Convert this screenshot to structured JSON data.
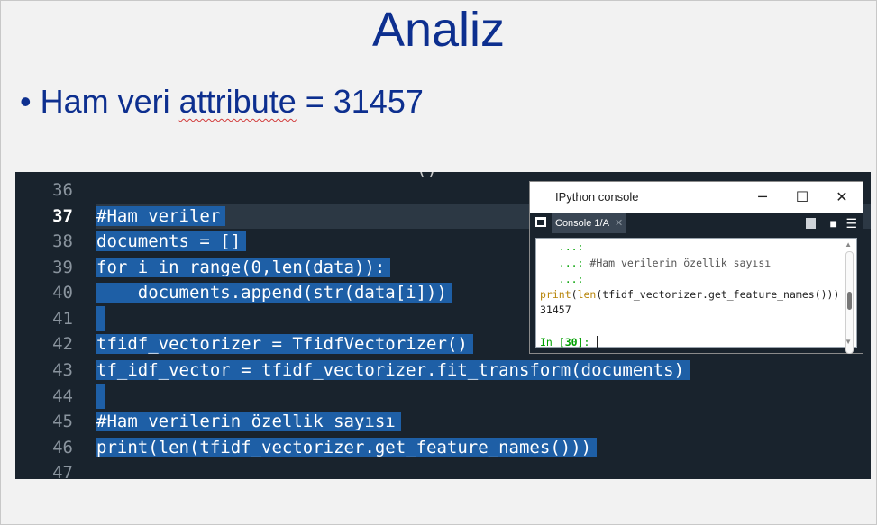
{
  "slide": {
    "title": "Analiz",
    "bullet": {
      "marker": "•",
      "prefix": "Ham veri ",
      "squiggle_word": "attribute",
      "suffix": " = 31457"
    }
  },
  "editor": {
    "top_fragment": "()",
    "line_numbers": [
      "36",
      "37",
      "38",
      "39",
      "40",
      "41",
      "42",
      "43",
      "44",
      "45",
      "46",
      "47"
    ],
    "active_line": "37",
    "code_lines": [
      "",
      "#Ham veriler",
      "documents = []",
      "for i in range(0,len(data)):",
      "    documents.append(str(data[i]))",
      "",
      "tfidf_vectorizer = TfidfVectorizer()",
      "tf_idf_vector = tfidf_vectorizer.fit_transform(documents)",
      "",
      "#Ham verilerin özellik sayısı",
      "print(len(tfidf_vectorizer.get_feature_names()))",
      ""
    ]
  },
  "console": {
    "window_title": "IPython console",
    "minimize": "─",
    "maximize": "☐",
    "close": "✕",
    "tab_label": "Console 1/A",
    "tab_close": "✕",
    "output": {
      "cont1": "   ...:",
      "cont2_prompt": "   ...: ",
      "cont2_comment": "#Ham verilerin özellik sayısı",
      "cont3": "   ...:",
      "print_fn": "print",
      "print_open": "(",
      "len_fn": "len",
      "print_rest": "(tfidf_vectorizer.get_feature_names()))",
      "result": "31457",
      "prompt_in": "In [",
      "prompt_num": "30",
      "prompt_close": "]: "
    },
    "colors": {
      "prompt_green": "#00a000",
      "continuation": "#00a000",
      "builtin": "#b8860b",
      "comment": "#666666"
    }
  },
  "colors": {
    "title_blue": "#0d2f8f",
    "editor_bg": "#19232d",
    "selection": "#1e5fa6",
    "current_line": "#2c3844"
  }
}
